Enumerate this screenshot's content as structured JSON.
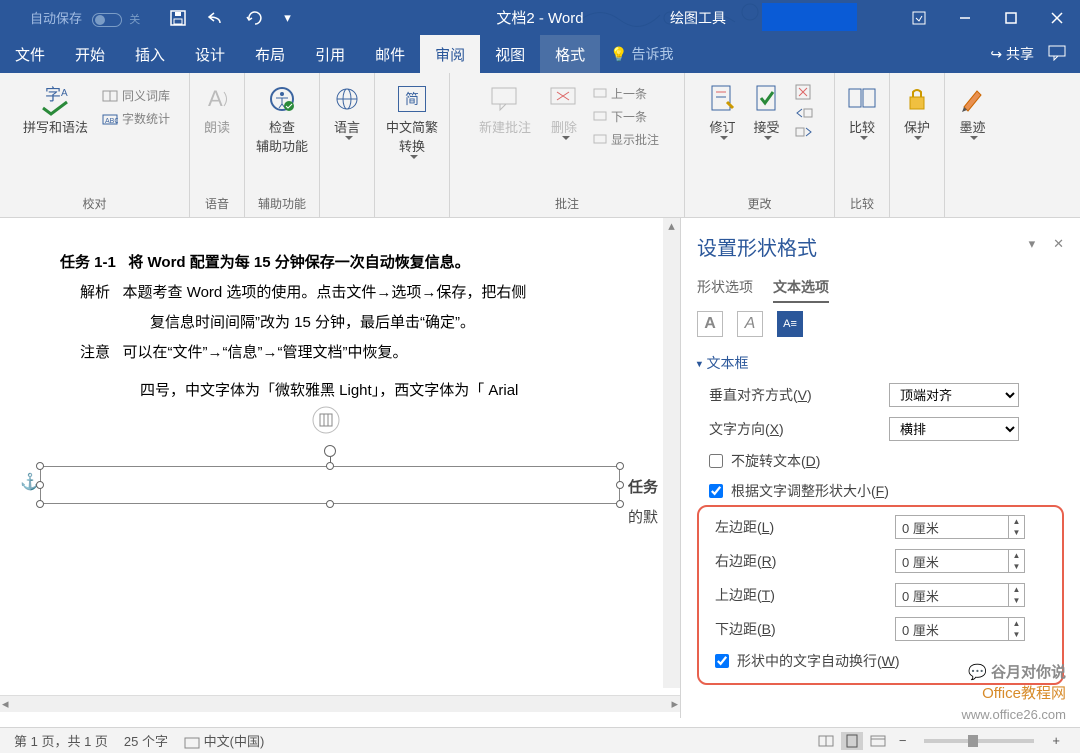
{
  "titlebar": {
    "autosave": "自动保存",
    "toggle": "关",
    "title": "文档2 - Word",
    "tools": "绘图工具"
  },
  "tabs": [
    "文件",
    "开始",
    "插入",
    "设计",
    "布局",
    "引用",
    "邮件",
    "审阅",
    "视图",
    "格式"
  ],
  "tell": "告诉我",
  "share": "共享",
  "ribbon": {
    "g1": {
      "spell": "拼写和语法",
      "thes": "同义词库",
      "wc": "字数统计",
      "lbl": "校对"
    },
    "g2": {
      "read": "朗读",
      "lbl": "语音"
    },
    "g3": {
      "check": "检查\n辅助功能",
      "lbl": "辅助功能"
    },
    "g4": {
      "lang": "语言",
      "lbl": ""
    },
    "g5": {
      "conv": "中文简繁\n转换",
      "simp": "简"
    },
    "g6": {
      "new": "新建批注",
      "del": "删除",
      "prev": "上一条",
      "next": "下一条",
      "show": "显示批注",
      "lbl": "批注"
    },
    "g7": {
      "track": "修订",
      "accept": "接受",
      "lbl": "更改"
    },
    "g8": {
      "compare": "比较",
      "lbl": "比较"
    },
    "g9": {
      "protect": "保护"
    },
    "g10": {
      "ink": "墨迹"
    }
  },
  "doc": {
    "l1a": "任务 1-1",
    "l1b": "将 Word 配置为每 15 分钟保存一次自动恢复信息。",
    "l2a": "解析",
    "l2b": "本题考查 Word 选项的使用。点击文件→选项→保存，把右侧",
    "l3": "复信息时间间隔”改为 15 分钟，最后单击“确定”。",
    "l4a": "注意",
    "l4b": "可以在“文件”→“信息”→“管理文档”中恢复。",
    "side1": "任务",
    "side2": "的默",
    "l5": "四号，中文字体为「微软雅黑 Light」，西文字体为「 Arial"
  },
  "pane": {
    "title": "设置形状格式",
    "tab1": "形状选项",
    "tab2": "文本选项",
    "section": "文本框",
    "valign": "垂直对齐方式(V)",
    "valign_v": "顶端对齐",
    "dir": "文字方向(X)",
    "dir_v": "横排",
    "norot": "不旋转文本(D)",
    "autofit": "根据文字调整形状大小(F)",
    "ml": "左边距(L)",
    "mr": "右边距(R)",
    "mt": "上边距(T)",
    "mb": "下边距(B)",
    "mval": "0 厘米",
    "wrap": "形状中的文字自动换行(W)"
  },
  "status": {
    "page": "第 1 页，共 1 页",
    "words": "25 个字",
    "lang": "中文(中国)"
  },
  "wm": {
    "a": "谷月对你说",
    "b": "Office教程网",
    "c": "www.office26.com"
  }
}
